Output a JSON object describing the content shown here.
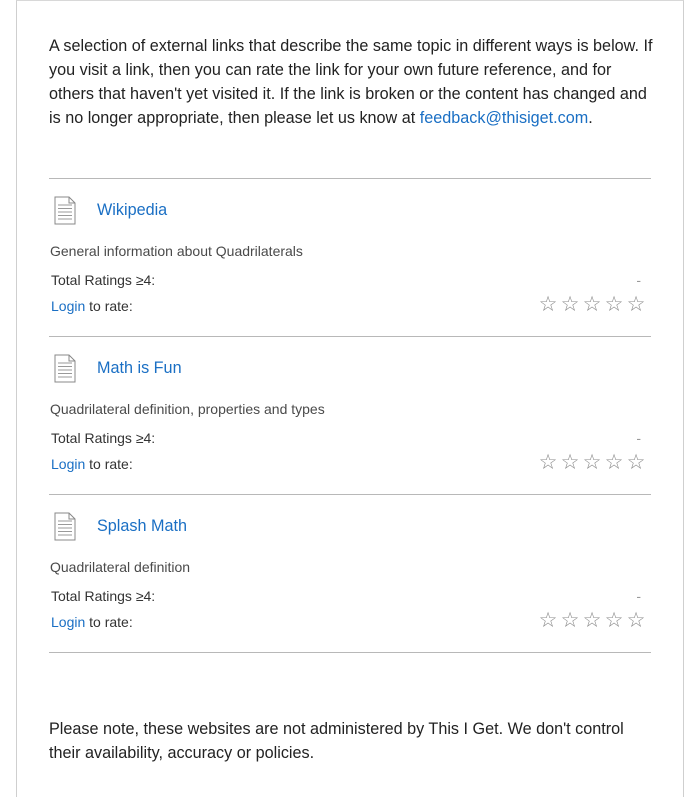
{
  "intro": {
    "text_before": "A selection of external links that describe the same topic in different ways is below. If you visit a link, then you can rate the link for your own future reference, and for others that haven't yet visited it. If the link is broken or the content has changed and is no longer appropriate, then please let us know at ",
    "email": "feedback@thisiget.com",
    "text_after": "."
  },
  "links": [
    {
      "title": "Wikipedia",
      "description": "General information about Quadrilaterals",
      "ratings_label": "Total Ratings ≥4:",
      "ratings_value": "-",
      "login_label": "Login",
      "to_rate_label": " to rate:",
      "stars": [
        "☆",
        "☆",
        "☆",
        "☆",
        "☆"
      ]
    },
    {
      "title": "Math is Fun",
      "description": "Quadrilateral definition, properties and types",
      "ratings_label": "Total Ratings ≥4:",
      "ratings_value": "-",
      "login_label": "Login",
      "to_rate_label": " to rate:",
      "stars": [
        "☆",
        "☆",
        "☆",
        "☆",
        "☆"
      ]
    },
    {
      "title": "Splash Math",
      "description": "Quadrilateral definition",
      "ratings_label": "Total Ratings ≥4:",
      "ratings_value": "-",
      "login_label": "Login",
      "to_rate_label": " to rate:",
      "stars": [
        "☆",
        "☆",
        "☆",
        "☆",
        "☆"
      ]
    }
  ],
  "note": "Please note, these websites are not administered by This I Get. We don't control their availability, accuracy or policies.",
  "colors": {
    "link": "#1a6fc4",
    "rule": "#b8b8b8",
    "star": "#8a8a8a"
  },
  "icons": {
    "document": "document-icon",
    "star": "star-outline-icon"
  }
}
